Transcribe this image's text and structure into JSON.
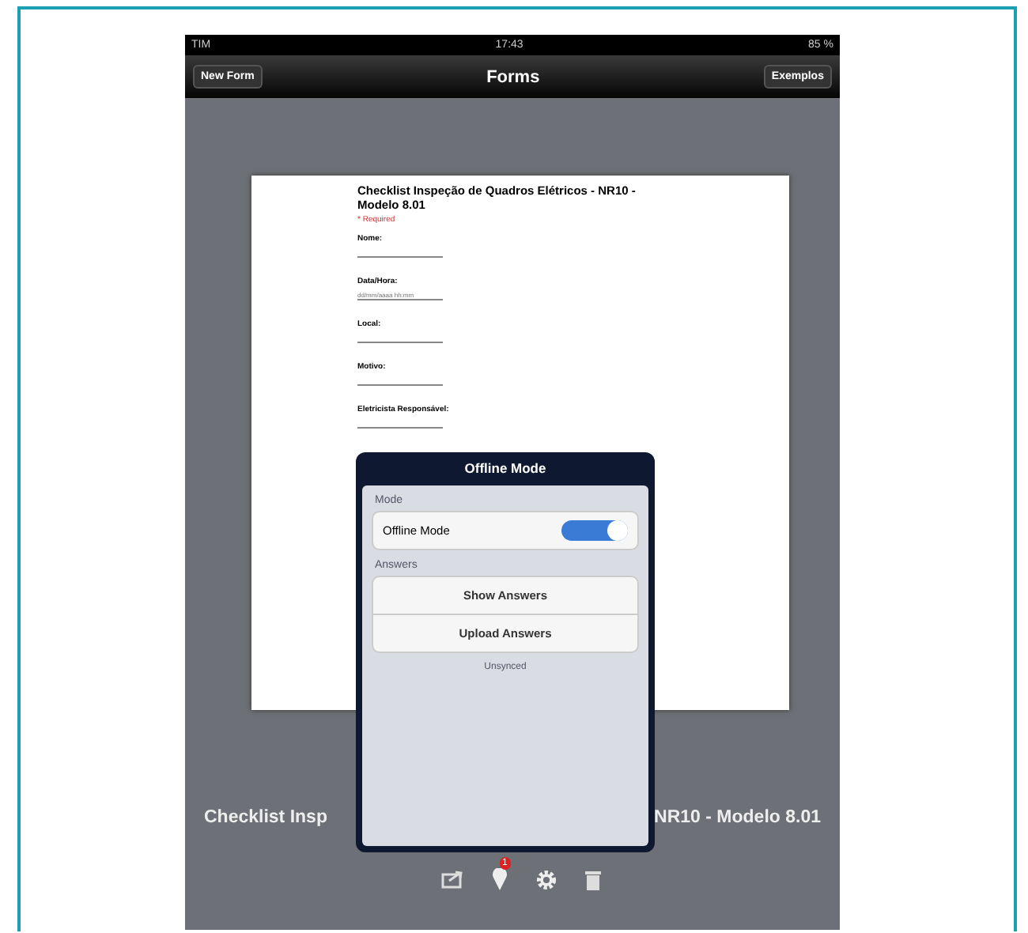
{
  "status_bar": {
    "carrier": "TIM",
    "time": "17:43",
    "battery": "85 %"
  },
  "nav_bar": {
    "left_button": "New Form",
    "title": "Forms",
    "right_button": "Exemplos"
  },
  "document": {
    "title": "Checklist Inspeção de Quadros Elétricos - NR10 - Modelo 8.01",
    "required_note": "* Required",
    "fields": [
      {
        "label": "Nome:"
      },
      {
        "label": "Data/Hora:",
        "placeholder": "dd/mm/aaaa hh:mm"
      },
      {
        "label": "Local:"
      },
      {
        "label": "Motivo:"
      },
      {
        "label": "Eletricista Responsável:"
      }
    ]
  },
  "form_caption": {
    "left_part": "Checklist Insp",
    "right_part": "NR10 - Modelo 8.01"
  },
  "popover": {
    "title": "Offline Mode",
    "sections": [
      {
        "header": "Mode",
        "rows": [
          {
            "kind": "toggle",
            "label": "Offline Mode",
            "on": true
          }
        ]
      },
      {
        "header": "Answers",
        "rows": [
          {
            "kind": "action",
            "label": "Show Answers"
          },
          {
            "kind": "action",
            "label": "Upload Answers"
          }
        ]
      }
    ],
    "footer": "Unsynced"
  },
  "toolbar": {
    "badge": "1"
  }
}
